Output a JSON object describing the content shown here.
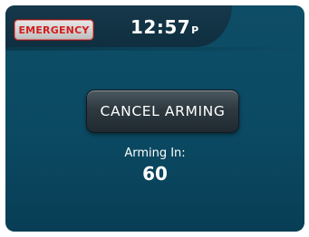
{
  "header": {
    "emergency_label": "EMERGENCY",
    "time": "12:57",
    "ampm": "P"
  },
  "main": {
    "cancel_arming_label": "CANCEL ARMING",
    "arming_in_label": "Arming In:",
    "arming_countdown": "60"
  },
  "colors": {
    "background": "#0b4a63",
    "top_bar": "#12344a",
    "emergency_text": "#d11f1f",
    "button": "#2e3940"
  }
}
